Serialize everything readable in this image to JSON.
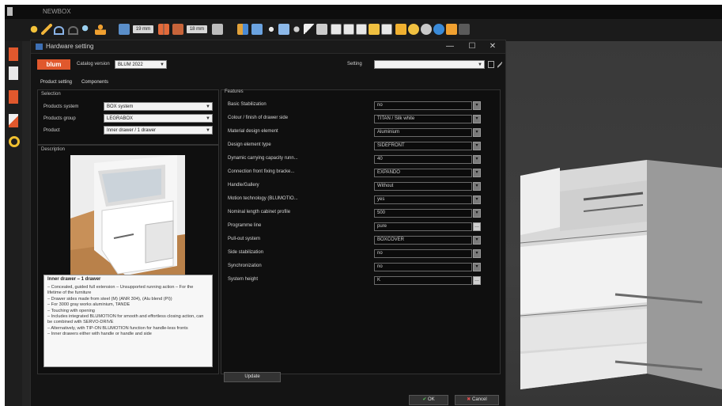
{
  "app": {
    "title": "NEWBOX"
  },
  "dialog": {
    "title": "Hardware setting",
    "brand": "blum",
    "catalog_label": "Catalog version",
    "catalog_value": "BLUM 2022",
    "setting_label": "Setting",
    "setting_value": "",
    "tabs": [
      "Product setting",
      "Components"
    ],
    "selection_title": "Selection",
    "selection": [
      {
        "label": "Products system",
        "value": "BOX system"
      },
      {
        "label": "Products group",
        "value": "LEGRABOX"
      },
      {
        "label": "Product",
        "value": "Inner drawer / 1 drawer"
      }
    ],
    "description_title": "Description",
    "features_title": "Features",
    "features": [
      {
        "label": "Basic Stabilization",
        "value": "no"
      },
      {
        "label": "Colour / finish of drawer side",
        "value": "TITAN / Silk white"
      },
      {
        "label": "Material design element",
        "value": "Aluminium"
      },
      {
        "label": "Design element type",
        "value": "SIDEFRONT"
      },
      {
        "label": "Dynamic carrying capacity runn...",
        "value": "40"
      },
      {
        "label": "Connection front fixing bracke...",
        "value": "EXPANDO"
      },
      {
        "label": "Handle/Gallery",
        "value": "Without"
      },
      {
        "label": "Motion technology (BLUMOTIO...",
        "value": "yes"
      },
      {
        "label": "Nominal length cabinet profile",
        "value": "500"
      },
      {
        "label": "Programme line",
        "value": "pure"
      },
      {
        "label": "Pull-out system",
        "value": "BOXCOVER"
      },
      {
        "label": "Side stabilization",
        "value": "no"
      },
      {
        "label": "Synchronization",
        "value": "no"
      },
      {
        "label": "System height",
        "value": "K"
      }
    ],
    "desc_box_title": "Inner drawer – 1 drawer",
    "desc_box_text": "– Concealed, guided full extension – Unsupported running action – For the lifetime of the furniture\n– Drawer sides made from steel (M) (ANR 304), (Alu blend (PI))\n– For 3000 gray works aluminium, TANDE\n– Touching with opening\n– Includes integrated BLUMOTION for smooth and effortless closing action, can be combined with SERVO-DRIVE\n– Alternatively, with TIP-ON BLUMOTION function for handle-less fronts\n– Inner drawers either with handle or handle and side",
    "update_label": "Update",
    "ok_label": "OK",
    "cancel_label": "Cancel"
  },
  "toolbar": {
    "pills": [
      "19 mm",
      "18 mm",
      "10 mm"
    ]
  },
  "colors": {
    "accent": "#e0582d",
    "dialog_bg": "#141414",
    "scene_bg": "#3b3b3b"
  }
}
